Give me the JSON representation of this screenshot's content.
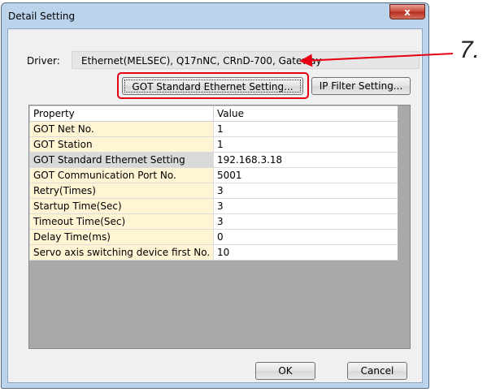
{
  "window": {
    "title": "Detail Setting",
    "close_label": "x"
  },
  "driver": {
    "label": "Driver:",
    "value": "Ethernet(MELSEC), Q17nNC, CRnD-700, Gateway"
  },
  "buttons": {
    "got_standard": "GOT Standard Ethernet Setting...",
    "ip_filter": "IP Filter Setting...",
    "ok": "OK",
    "cancel": "Cancel"
  },
  "table": {
    "columns": [
      "Property",
      "Value"
    ],
    "rows": [
      {
        "property": "GOT Net No.",
        "value": "1"
      },
      {
        "property": "GOT Station",
        "value": "1"
      },
      {
        "property": "GOT Standard Ethernet Setting",
        "value": "192.168.3.18"
      },
      {
        "property": "GOT Communication Port No.",
        "value": "5001"
      },
      {
        "property": "Retry(Times)",
        "value": "3"
      },
      {
        "property": "Startup Time(Sec)",
        "value": "3"
      },
      {
        "property": "Timeout Time(Sec)",
        "value": "3"
      },
      {
        "property": "Delay Time(ms)",
        "value": "0"
      },
      {
        "property": "Servo axis switching device first No.",
        "value": "10"
      }
    ]
  },
  "annotation": {
    "step_label": "7.",
    "color": "#e60012"
  }
}
